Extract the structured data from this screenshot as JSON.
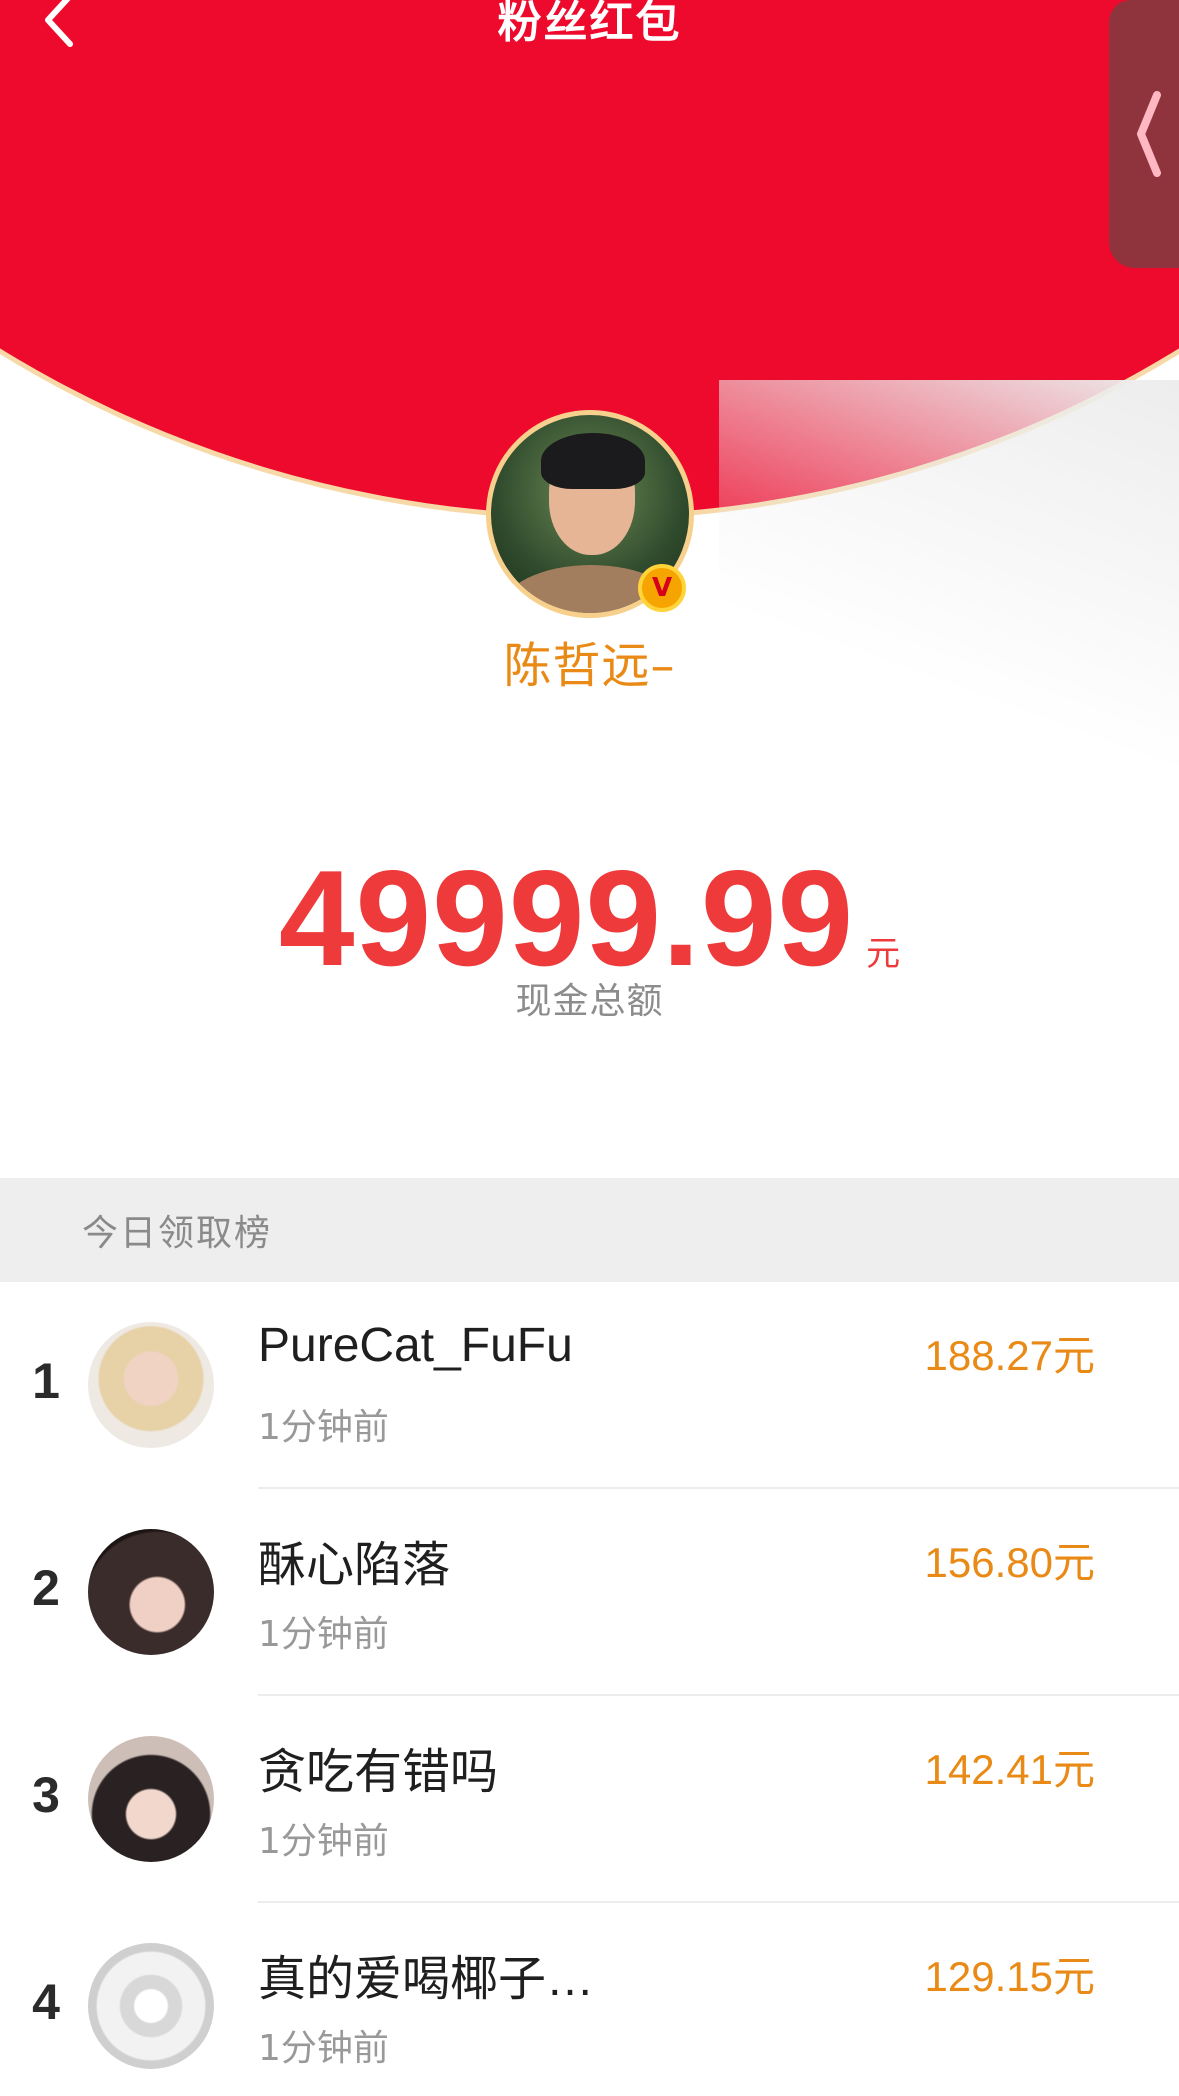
{
  "header": {
    "title": "粉丝红包",
    "back_icon": "chevron-left-icon",
    "side_tab_icon": "chevron-left-icon",
    "colors": {
      "red": "#ee0a2d",
      "gold": "#f6d9a6",
      "side_tab": "#8f343c"
    }
  },
  "creator": {
    "name": "陈哲远–",
    "verified_badge": "V",
    "badge_color": "#f5a400",
    "name_color": "#e98a16"
  },
  "total": {
    "amount": "49999.99",
    "unit": "元",
    "label": "现金总额",
    "amount_color": "#ee3a3a"
  },
  "ranking": {
    "title": "今日领取榜",
    "rows": [
      {
        "rank": "1",
        "name": "PureCat_FuFu",
        "time": "1分钟前",
        "amount": "188.27元"
      },
      {
        "rank": "2",
        "name": "酥心陷落",
        "time": "1分钟前",
        "amount": "156.80元"
      },
      {
        "rank": "3",
        "name": "贪吃有错吗",
        "time": "1分钟前",
        "amount": "142.41元"
      },
      {
        "rank": "4",
        "name": "真的爱喝椰子…",
        "time": "1分钟前",
        "amount": "129.15元"
      }
    ],
    "amount_color": "#e98a16"
  }
}
